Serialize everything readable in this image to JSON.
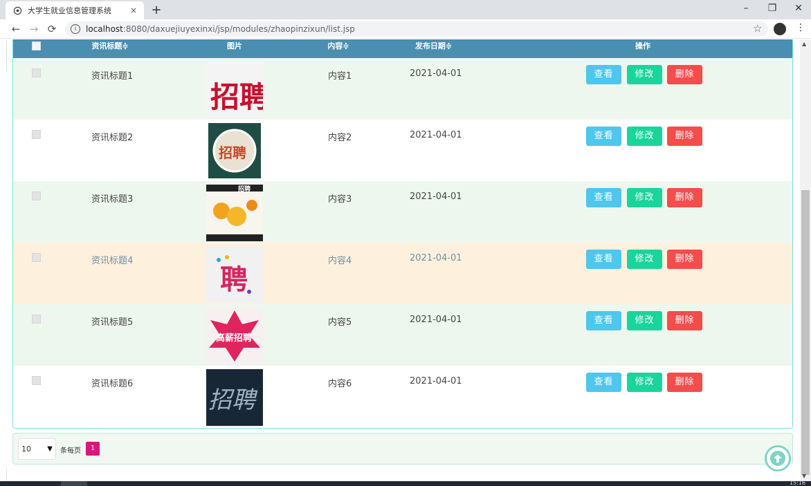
{
  "browser": {
    "tab_title": "大学生就业信息管理系统",
    "tab_close": "×",
    "newtab": "+",
    "url_host": "localhost",
    "url_path": ":8080/daxuejiuyexinxi/jsp/modules/zhaopinzixun/list.jsp",
    "minimize": "–",
    "restore": "❐",
    "close": "✕"
  },
  "table": {
    "headers": {
      "title": "资讯标题≑",
      "image": "图片",
      "content": "内容≑",
      "date": "发布日期≑",
      "actions": "操作"
    },
    "buttons": {
      "view": "查看",
      "edit": "修改",
      "delete": "删除"
    },
    "rows": [
      {
        "title": "资讯标题1",
        "content": "内容1",
        "date": "2021-04-01",
        "image_text": "招聘"
      },
      {
        "title": "资讯标题2",
        "content": "内容2",
        "date": "2021-04-01",
        "image_text": "招聘"
      },
      {
        "title": "资讯标题3",
        "content": "内容3",
        "date": "2021-04-01",
        "image_text": "招聘"
      },
      {
        "title": "资讯标题4",
        "content": "内容4",
        "date": "2021-04-01",
        "image_text": "聘"
      },
      {
        "title": "资讯标题5",
        "content": "内容5",
        "date": "2021-04-01",
        "image_text": "高薪招聘"
      },
      {
        "title": "资讯标题6",
        "content": "内容6",
        "date": "2021-04-01",
        "image_text": "招聘"
      }
    ]
  },
  "pagination": {
    "page_size": "10",
    "per_page_label": "条每页",
    "current_page": "1"
  },
  "taskbar": {
    "clock": "15:16"
  },
  "colors": {
    "header": "#4a8fb0",
    "row_alt": "#eef7ee",
    "row_hover": "#fdf1de",
    "view": "#4ec6ee",
    "edit": "#19d59b",
    "delete": "#f54c4c",
    "page_active": "#d6187c"
  }
}
